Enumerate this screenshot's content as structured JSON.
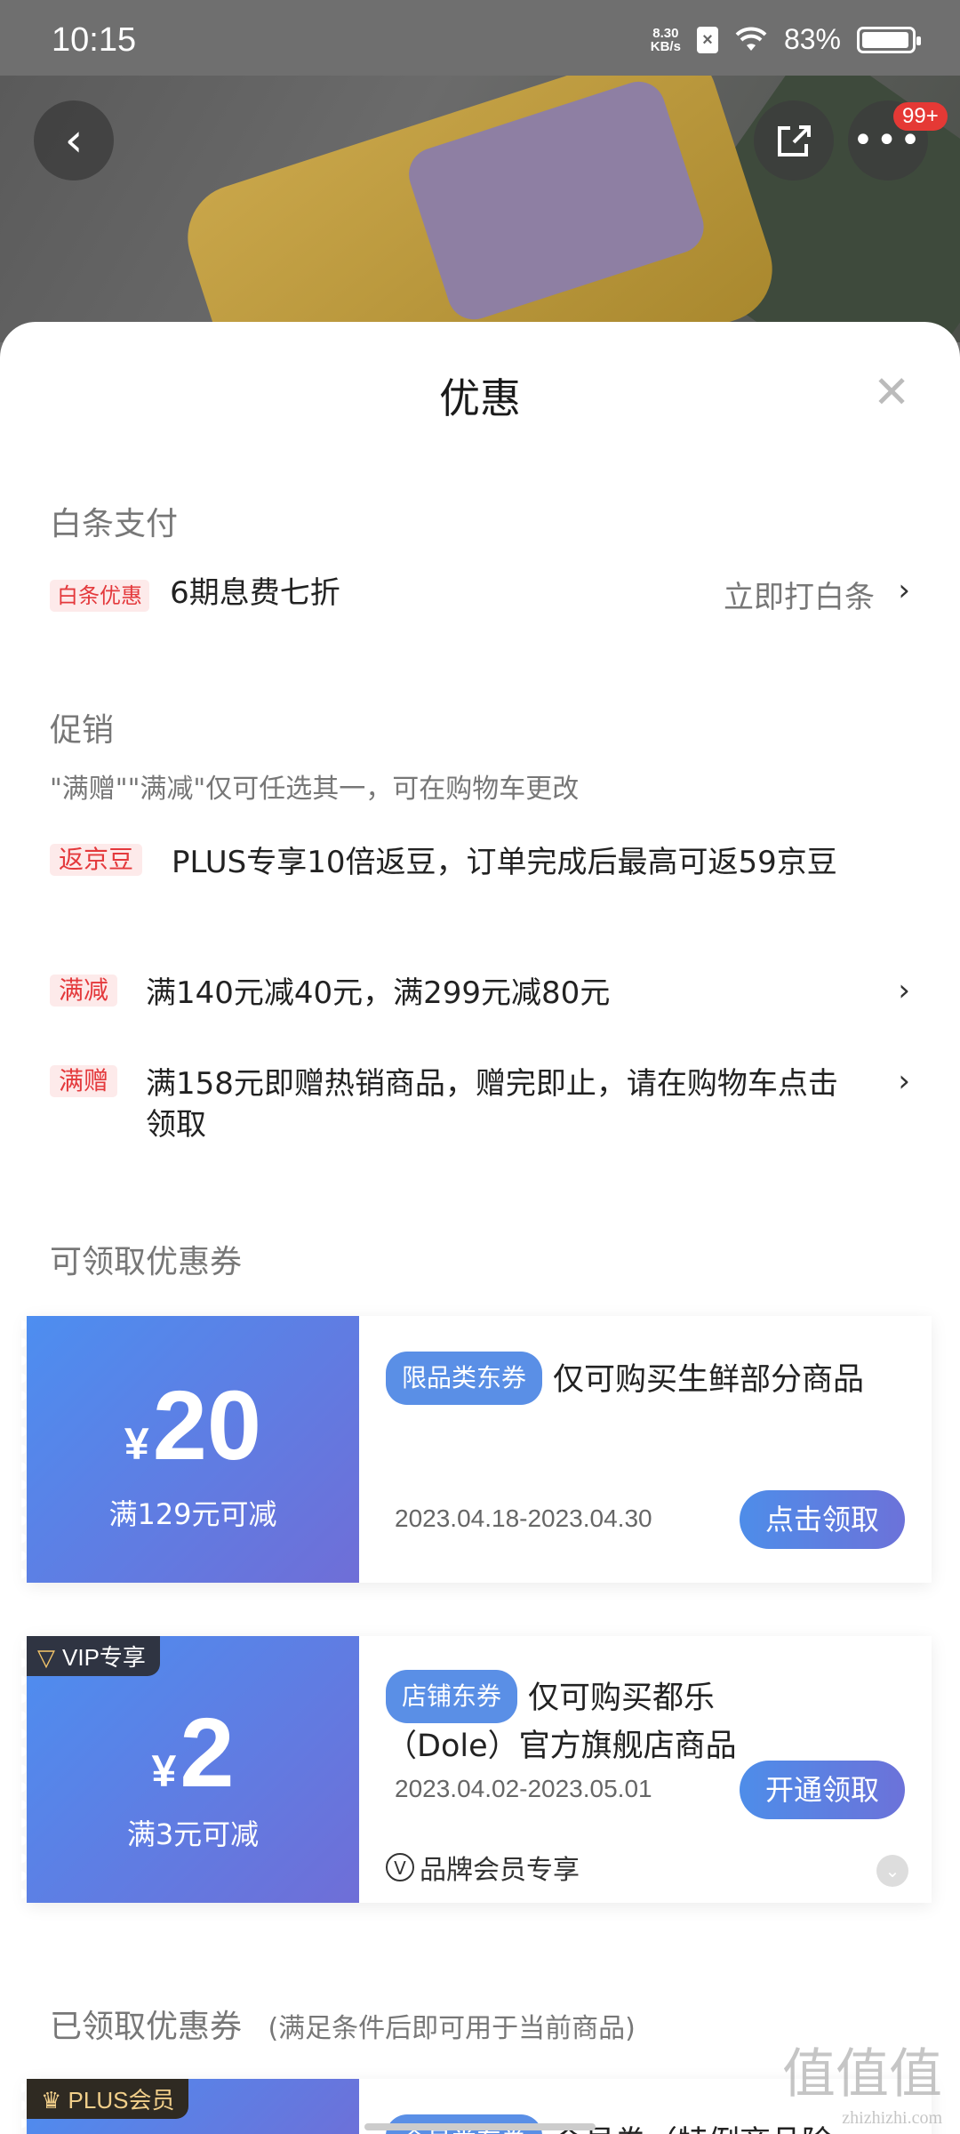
{
  "status_bar": {
    "time": "10:15",
    "net_speed_top": "8.30",
    "net_speed_unit": "KB/s",
    "battery": "83%",
    "battery_level": 0.83
  },
  "header": {
    "more_badge": "99+"
  },
  "sheet": {
    "title": "优惠",
    "baitiao": {
      "section_title": "白条支付",
      "tag": "白条优惠",
      "text": "6期息费七折",
      "action": "立即打白条"
    },
    "promo": {
      "section_title": "促销",
      "note": "\"满赠\"\"满减\"仅可任选其一，可在购物车更改",
      "items": [
        {
          "tag": "返京豆",
          "text": "PLUS专享10倍返豆，订单完成后最高可返59京豆"
        },
        {
          "tag": "满减",
          "text": "满140元减40元，满299元减80元"
        },
        {
          "tag": "满赠",
          "text": "满158元即赠热销商品，赠完即止，请在购物车点击领取"
        }
      ]
    },
    "available_coupons": {
      "section_title": "可领取优惠券",
      "coupons": [
        {
          "currency": "¥",
          "amount": "20",
          "condition": "满129元可减",
          "tag": "限品类东券",
          "desc": "仅可购买生鲜部分商品",
          "date": "2023.04.18-2023.04.30",
          "button": "点击领取"
        },
        {
          "badge": "VIP专享",
          "currency": "¥",
          "amount": "2",
          "condition": "满3元可减",
          "tag": "店铺东券",
          "desc": "仅可购买都乐（Dole）官方旗舰店商品",
          "date": "2023.04.02-2023.05.01",
          "button": "开通领取",
          "member_note": "品牌会员专享"
        }
      ]
    },
    "claimed_coupons": {
      "section_title": "已领取优惠券",
      "subtitle": "(满足条件后即可用于当前商品)",
      "partial_badge": "PLUS会员",
      "partial_tag": "会员类东券",
      "partial_desc": "会员券（特例商品除"
    }
  },
  "watermark": {
    "main": "值值值",
    "sub": "zhizhizhi.com"
  }
}
